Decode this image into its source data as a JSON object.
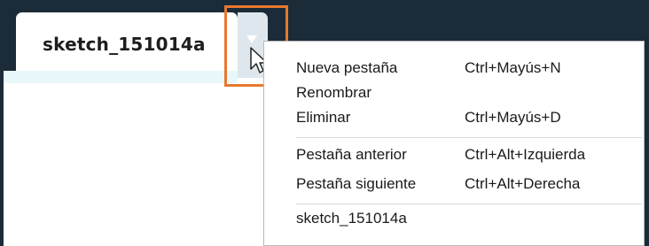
{
  "tab": {
    "title": "sketch_151014a",
    "menu_icon": "chevron-down-icon"
  },
  "cursor_icon": "pointer-cursor-icon",
  "highlight_color": "#e8782f",
  "menu": {
    "items": [
      {
        "label": "Nueva pestaña",
        "shortcut": "Ctrl+Mayús+N"
      },
      {
        "label": "Renombrar",
        "shortcut": ""
      },
      {
        "label": "Eliminar",
        "shortcut": "Ctrl+Mayús+D"
      },
      {
        "label": "Pestaña anterior",
        "shortcut": "Ctrl+Alt+Izquierda"
      },
      {
        "label": "Pestaña siguiente",
        "shortcut": "Ctrl+Alt+Derecha"
      },
      {
        "label": "sketch_151014a",
        "shortcut": ""
      }
    ]
  }
}
